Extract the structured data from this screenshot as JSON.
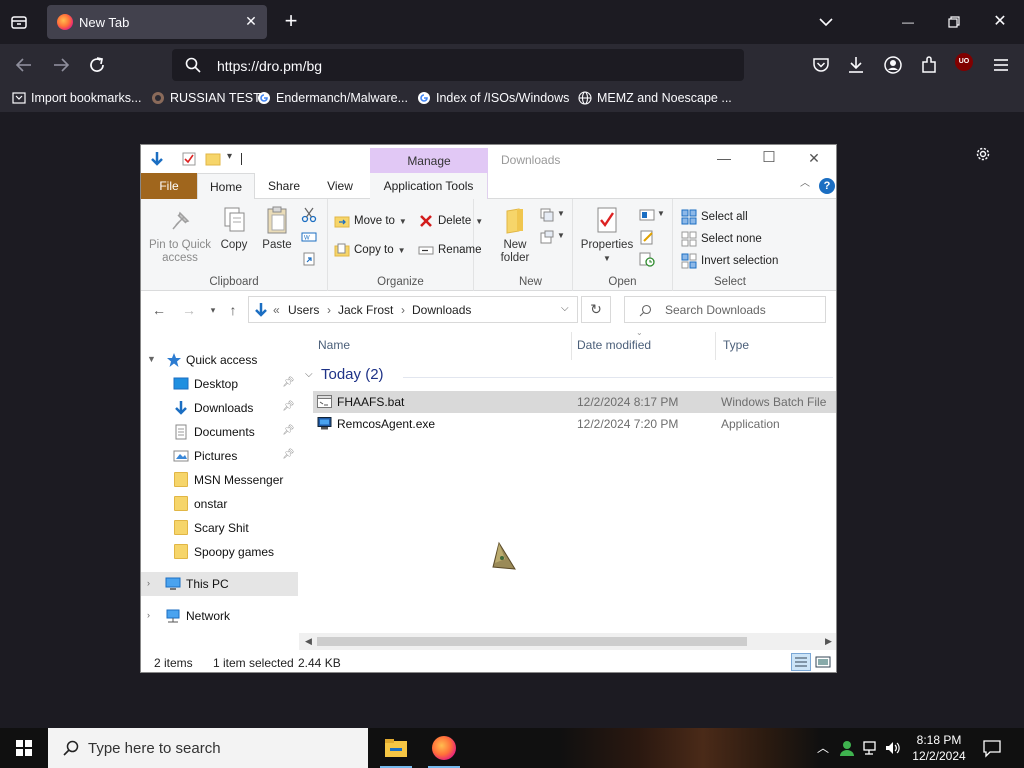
{
  "browser": {
    "tab": {
      "title": "New Tab"
    },
    "url": "https://dro.pm/bg",
    "bookmarks": [
      {
        "label": "Import bookmarks...",
        "icon": "import-icon"
      },
      {
        "label": "RUSSIAN TEST",
        "icon": "site-favicon"
      },
      {
        "label": "Endermanch/Malware...",
        "icon": "google-favicon"
      },
      {
        "label": "Index of /ISOs/Windows",
        "icon": "google-favicon"
      },
      {
        "label": "MEMZ and Noescape ...",
        "icon": "globe-icon"
      }
    ],
    "addon_badge": "UO"
  },
  "explorer": {
    "context_tab": "Manage",
    "title": "Downloads",
    "ribbon_tabs": [
      "File",
      "Home",
      "Share",
      "View",
      "Application Tools"
    ],
    "groups": {
      "clipboard": {
        "label": "Clipboard",
        "pin_line1": "Pin to Quick",
        "pin_line2": "access",
        "copy": "Copy",
        "paste": "Paste"
      },
      "organize": {
        "label": "Organize",
        "move_to": "Move to",
        "copy_to": "Copy to",
        "delete": "Delete",
        "rename": "Rename"
      },
      "new": {
        "label": "New",
        "new_folder_line1": "New",
        "new_folder_line2": "folder"
      },
      "open": {
        "label": "Open",
        "properties": "Properties"
      },
      "select": {
        "label": "Select",
        "select_all": "Select all",
        "select_none": "Select none",
        "invert": "Invert selection"
      }
    },
    "address": {
      "overflow": "«",
      "crumbs": [
        "Users",
        "Jack Frost",
        "Downloads"
      ]
    },
    "search_placeholder": "Search Downloads",
    "nav": {
      "quick_access": "Quick access",
      "items": [
        "Desktop",
        "Downloads",
        "Documents",
        "Pictures",
        "MSN Messenger",
        "onstar",
        "Scary Shit",
        "Spoopy games"
      ],
      "this_pc": "This PC",
      "network": "Network"
    },
    "columns": [
      "Name",
      "Date modified",
      "Type"
    ],
    "group": "Today (2)",
    "files": [
      {
        "name": "FHAAFS.bat",
        "date": "12/2/2024 8:17 PM",
        "type": "Windows Batch File",
        "selected": true
      },
      {
        "name": "RemcosAgent.exe",
        "date": "12/2/2024 7:20 PM",
        "type": "Application",
        "selected": false
      }
    ],
    "status": {
      "count": "2 items",
      "selection": "1 item selected",
      "size": "2.44 KB"
    }
  },
  "taskbar": {
    "search_placeholder": "Type here to search",
    "time": "8:18 PM",
    "date": "12/2/2024"
  },
  "colors": {
    "browser_bg": "#1c1b22",
    "toolbar": "#2b2a33",
    "file_tab": "#a0661d",
    "manage_tab": "#e1c8f5",
    "selection": "#d9d9d9",
    "group_header": "#1e3287"
  }
}
